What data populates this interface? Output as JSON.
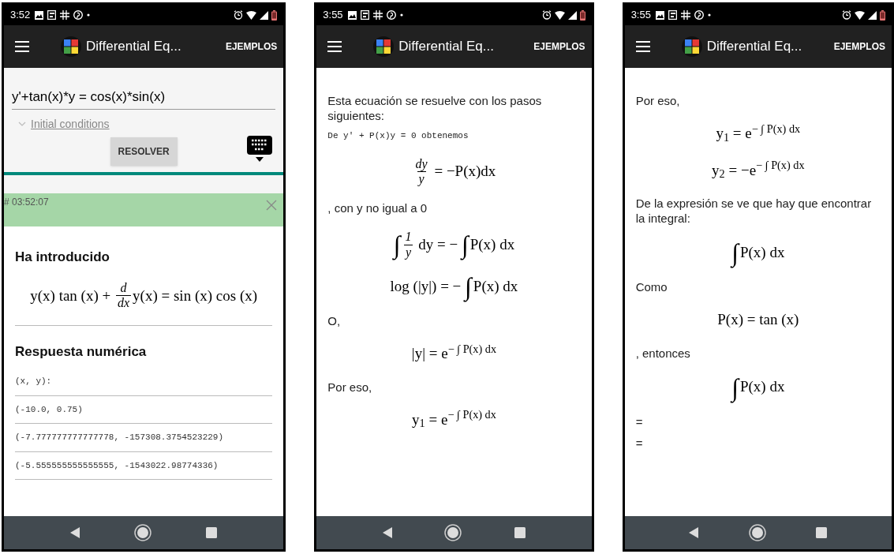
{
  "phones": [
    {
      "time": "3:52",
      "title": "Differential Eq...",
      "action": "EJEMPLOS",
      "form": {
        "value": "y'+tan(x)*y = cos(x)*sin(x)",
        "conditions": {
          "label": "Initial conditions",
          "expanded": false
        },
        "submit": "RESOLVER",
        "banner": "# 03:52:07"
      },
      "blocks": [
        {
          "kind": "heading",
          "text": "Ha introducido"
        },
        {
          "kind": "math",
          "parts": [
            {
              "kind": "t",
              "text": "y(x) tan (x) + "
            },
            {
              "kind": "frac",
              "num": "d",
              "den": "dx"
            },
            {
              "kind": "t",
              "text": "y(x) = sin (x) cos (x)"
            }
          ]
        },
        {
          "kind": "divider"
        },
        {
          "kind": "heading",
          "text": "Respuesta numérica"
        },
        {
          "kind": "row",
          "text": "(x, y):"
        },
        {
          "kind": "row",
          "text": "(-10.0, 0.75)"
        },
        {
          "kind": "row",
          "text": "(-7.777777777777778, -157308.3754523229)"
        },
        {
          "kind": "row",
          "text": "(-5.555555555555555, -1543022.98774336)"
        }
      ]
    },
    {
      "time": "3:55",
      "title": "Differential Eq...",
      "action": "EJEMPLOS",
      "blocks": [
        {
          "kind": "text",
          "text": "Esta ecuación se resuelve con los pasos siguientes:"
        },
        {
          "kind": "mono",
          "text": "De y' + P(x)y = 0 obtenemos"
        },
        {
          "kind": "math",
          "parts": [
            {
              "kind": "frac",
              "num": "dy",
              "den": "y"
            },
            {
              "kind": "t",
              "text": " = −P(x)dx"
            }
          ]
        },
        {
          "kind": "text",
          "text": ", con y no igual a 0"
        },
        {
          "kind": "math",
          "parts": [
            {
              "kind": "int",
              "text": "∫"
            },
            {
              "kind": "frac",
              "num": "1",
              "den": "y"
            },
            {
              "kind": "t",
              "text": " dy = − "
            },
            {
              "kind": "int",
              "text": "∫"
            },
            {
              "kind": "t",
              "text": "P(x) dx"
            }
          ]
        },
        {
          "kind": "math",
          "parts": [
            {
              "kind": "t",
              "text": "log (|y|) = − "
            },
            {
              "kind": "int",
              "text": "∫"
            },
            {
              "kind": "t",
              "text": "P(x) dx"
            }
          ]
        },
        {
          "kind": "text",
          "text": "O,"
        },
        {
          "kind": "math",
          "parts": [
            {
              "kind": "t",
              "text": "|y| = e$^{− ∫ P(x) dx}$"
            }
          ]
        },
        {
          "kind": "text",
          "text": "Por eso,"
        },
        {
          "kind": "math",
          "parts": [
            {
              "kind": "t",
              "text": "y$_{1}$ = e$^{− ∫ P(x) dx}$"
            }
          ]
        }
      ]
    },
    {
      "time": "3:55",
      "title": "Differential Eq...",
      "action": "EJEMPLOS",
      "blocks": [
        {
          "kind": "text",
          "text": "Por eso,"
        },
        {
          "kind": "math",
          "parts": [
            {
              "kind": "t",
              "text": "y$_{1}$ = e$^{− ∫ P(x) dx}$"
            }
          ]
        },
        {
          "kind": "math",
          "parts": [
            {
              "kind": "t",
              "text": "y$_{2}$ = −e$^{− ∫ P(x) dx}$"
            }
          ]
        },
        {
          "kind": "text",
          "text": "De la expresión se ve que hay que encontrar la integral:"
        },
        {
          "kind": "math",
          "parts": [
            {
              "kind": "int",
              "text": "∫"
            },
            {
              "kind": "t",
              "text": "P(x) dx"
            }
          ]
        },
        {
          "kind": "text",
          "text": "Como"
        },
        {
          "kind": "math",
          "parts": [
            {
              "kind": "t",
              "text": "P(x) = tan (x)"
            }
          ]
        },
        {
          "kind": "text",
          "text": ", entonces"
        },
        {
          "kind": "math",
          "parts": [
            {
              "kind": "int",
              "text": "∫"
            },
            {
              "kind": "t",
              "text": "P(x) dx"
            }
          ]
        },
        {
          "kind": "text",
          "text": "="
        },
        {
          "kind": "text",
          "text": "="
        }
      ]
    }
  ]
}
